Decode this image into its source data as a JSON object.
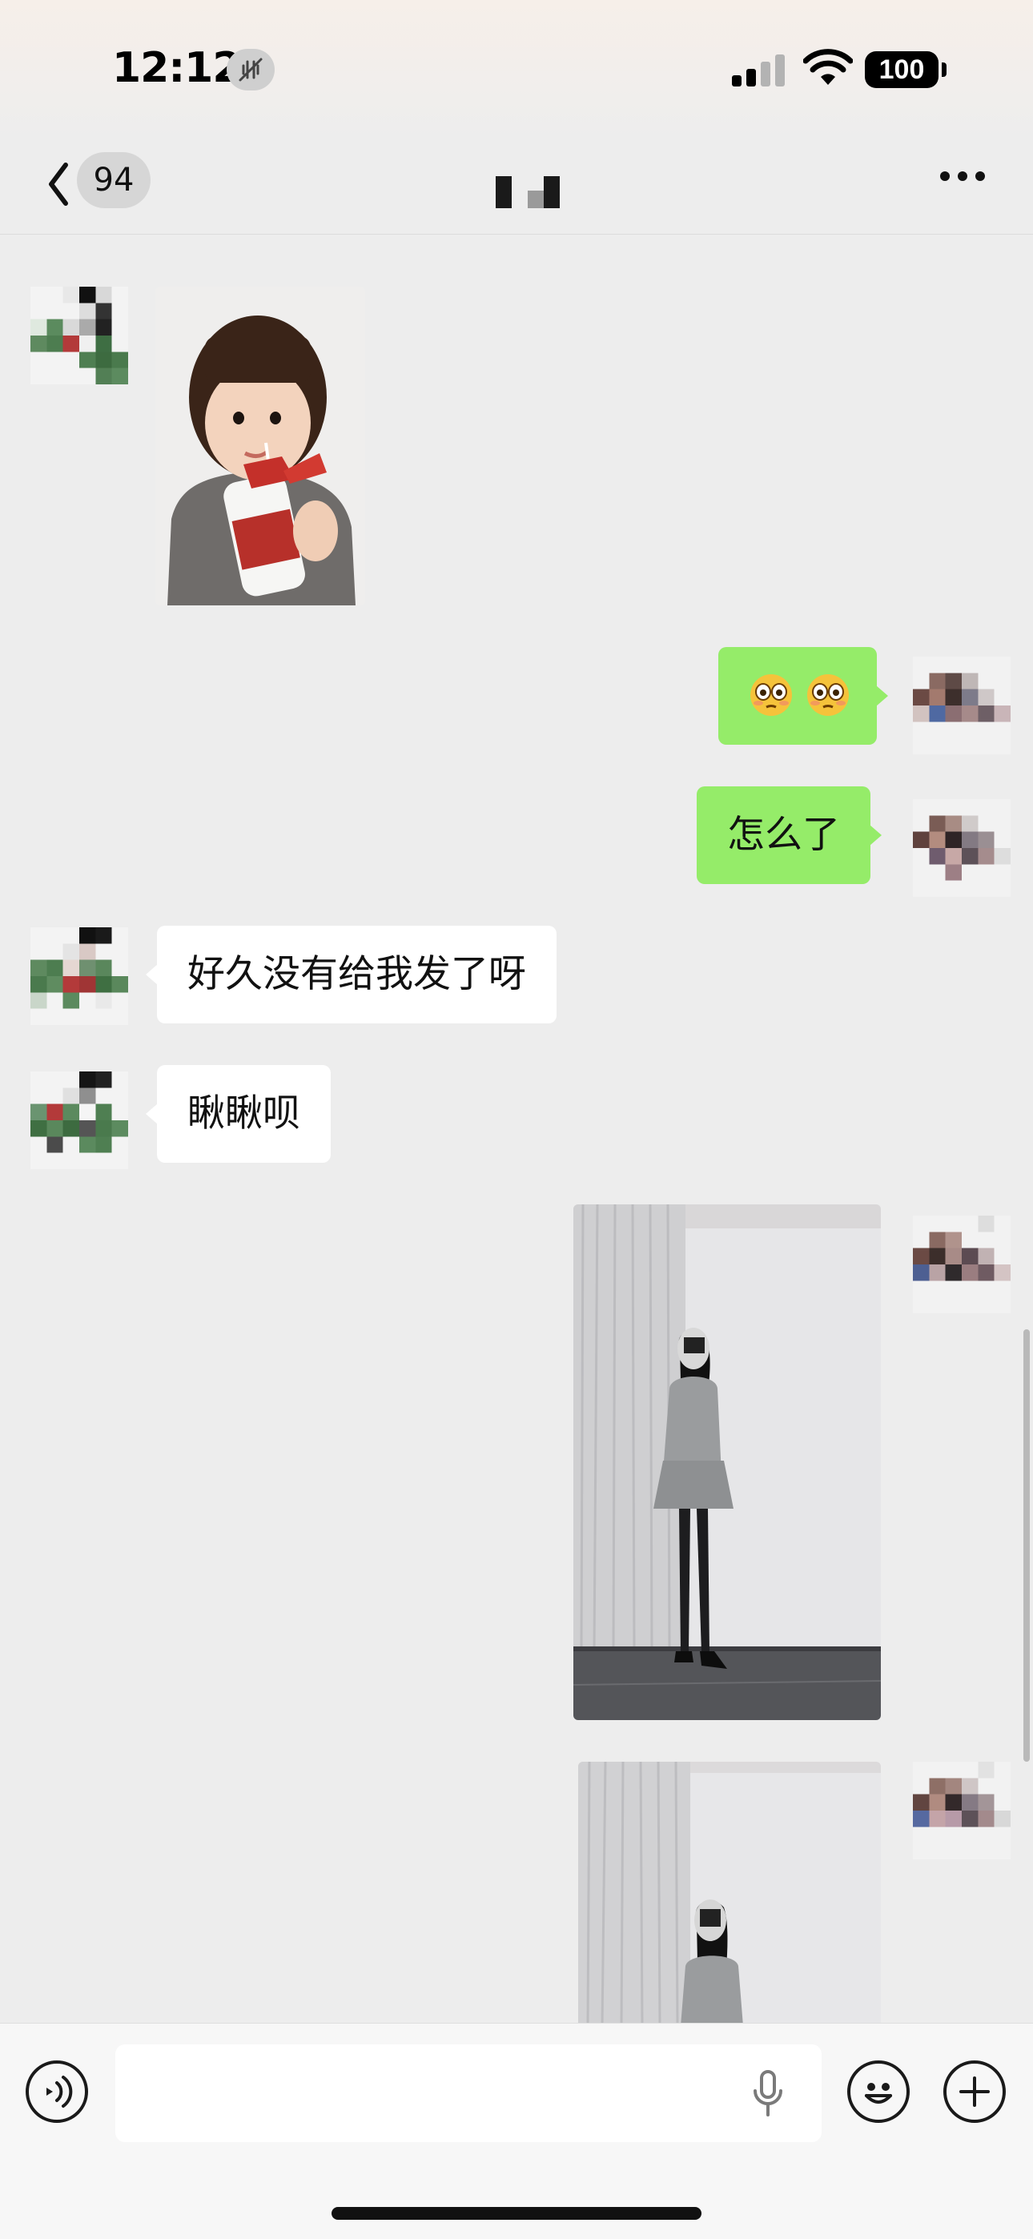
{
  "status_bar": {
    "time": "12:12",
    "battery_level": "100",
    "icons": [
      "silent-mode-icon",
      "cellular-signal-icon",
      "wifi-icon",
      "battery-icon"
    ]
  },
  "nav": {
    "unread_count": "94",
    "icons": [
      "back-chevron-icon",
      "more-dots-icon"
    ]
  },
  "messages": [
    {
      "id": "m1",
      "direction": "incoming",
      "type": "image",
      "content": "sticker-girl-with-bottle"
    },
    {
      "id": "m2",
      "direction": "outgoing",
      "type": "emoji",
      "content": "😳😳"
    },
    {
      "id": "m3",
      "direction": "outgoing",
      "type": "text",
      "text": "怎么了"
    },
    {
      "id": "m4",
      "direction": "incoming",
      "type": "text",
      "text": "好久没有给我发了呀"
    },
    {
      "id": "m5",
      "direction": "incoming",
      "type": "text",
      "text": "瞅瞅呗"
    },
    {
      "id": "m6",
      "direction": "outgoing",
      "type": "image",
      "content": "photo-mirror-selfie-full"
    },
    {
      "id": "m7",
      "direction": "outgoing",
      "type": "image",
      "content": "photo-mirror-selfie-cropped"
    }
  ],
  "input_bar": {
    "placeholder": "",
    "icons": [
      "voice-mode-icon",
      "microphone-icon",
      "emoji-face-icon",
      "plus-circle-icon"
    ]
  },
  "colors": {
    "background": "#ededed",
    "outgoing_bubble": "#95ec69",
    "incoming_bubble": "#ffffff",
    "input_bar": "#f7f7f7"
  }
}
